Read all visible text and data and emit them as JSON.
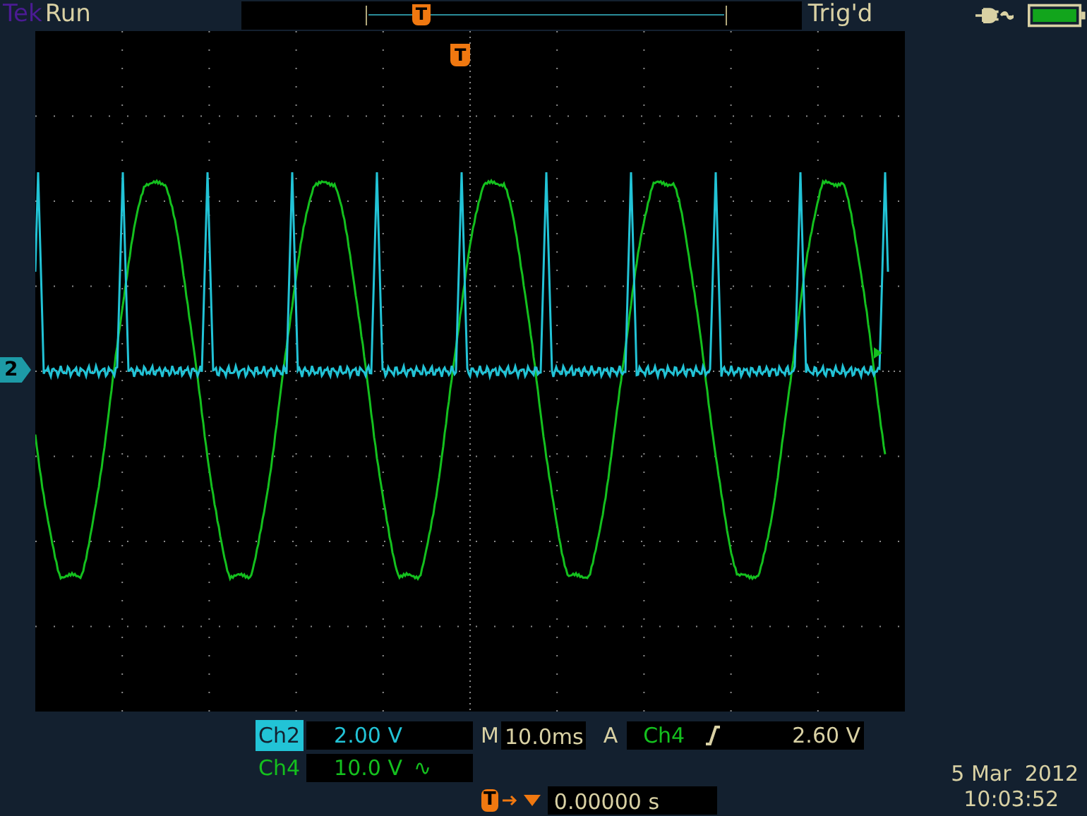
{
  "header": {
    "brand": "Tek",
    "acquisition": "Run",
    "trigger_marker": "T",
    "trigger_status": "Trig'd"
  },
  "plot": {
    "trigger_marker": "T",
    "ground_marker": "2"
  },
  "channels": [
    {
      "name": "Ch2",
      "scale": "2.00 V",
      "selected": true,
      "color": "#22c3d6"
    },
    {
      "name": "Ch4",
      "scale": "10.0 V",
      "selected": false,
      "color": "#14c01e",
      "bandwidth_limit": "∿"
    }
  ],
  "timebase": {
    "label": "M",
    "value": "10.0ms"
  },
  "trigger": {
    "label": "A",
    "source": "Ch4",
    "level": "2.60 V"
  },
  "trigger_position": {
    "marker": "T",
    "value": "0.00000 s"
  },
  "date": "5 Mar  2012",
  "time": "10:03:52"
}
